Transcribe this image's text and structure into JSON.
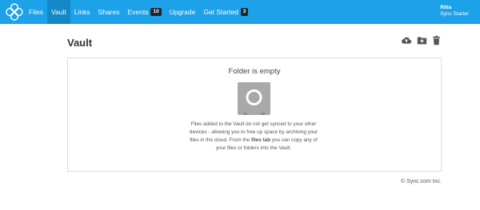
{
  "brand": {
    "logo": "sync-logo-icon"
  },
  "nav": {
    "files": "Files",
    "vault": "Vault",
    "links": "Links",
    "shares": "Shares",
    "events": "Events",
    "events_badge": "10",
    "upgrade": "Upgrade",
    "get_started": "Get Started",
    "get_started_badge": "3"
  },
  "user": {
    "name": "Ritia",
    "plan": "Sync Starter"
  },
  "page": {
    "title": "Vault"
  },
  "toolbar": {
    "icons": [
      "cloud-upload-icon",
      "new-folder-icon",
      "trash-icon"
    ]
  },
  "empty_state": {
    "title": "Folder is empty",
    "icon": "vault-safe-icon",
    "desc_part1": "Files added to the Vault do not get synced to your other devices - allowing you to free up space by archiving your files in the cloud. From the ",
    "desc_link": "files tab",
    "desc_part2": " you can copy any of your files or folders into the Vault."
  },
  "footer": {
    "copyright": "© Sync.com Inc."
  },
  "colors": {
    "topbar": "#1da1e8",
    "nav_active": "#1589c8",
    "badge": "#1a2633",
    "vault_icon": "#a9a9a9"
  }
}
